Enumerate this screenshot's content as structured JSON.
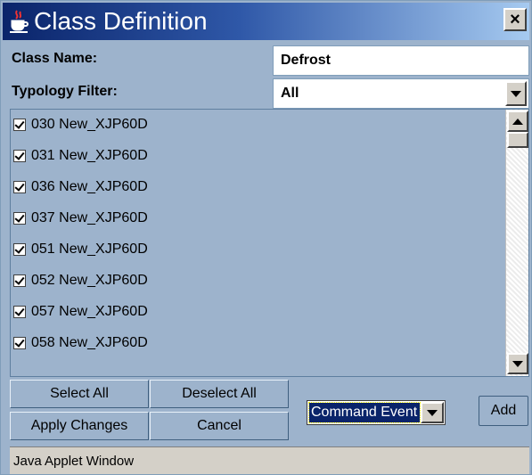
{
  "window": {
    "title": "Class Definition",
    "close_label": "×"
  },
  "form": {
    "class_name_label": "Class Name:",
    "class_name_value": "Defrost",
    "typology_filter_label": "Typology Filter:",
    "typology_filter_value": "All"
  },
  "list": {
    "items": [
      {
        "label": "030 New_XJP60D",
        "checked": true
      },
      {
        "label": "031 New_XJP60D",
        "checked": true
      },
      {
        "label": "036 New_XJP60D",
        "checked": true
      },
      {
        "label": "037 New_XJP60D",
        "checked": true
      },
      {
        "label": "051 New_XJP60D",
        "checked": true
      },
      {
        "label": "052 New_XJP60D",
        "checked": true
      },
      {
        "label": "057 New_XJP60D",
        "checked": true
      },
      {
        "label": "058 New_XJP60D",
        "checked": true
      }
    ]
  },
  "buttons": {
    "select_all": "Select All",
    "deselect_all": "Deselect All",
    "apply_changes": "Apply Changes",
    "cancel": "Cancel",
    "add": "Add"
  },
  "event_combo": {
    "value": "Command Event"
  },
  "status": {
    "text": "Java Applet Window"
  },
  "icons": {
    "title_icon": "java-coffee-cup-icon",
    "close_icon": "close-icon",
    "dropdown_icon": "chevron-down-icon",
    "scroll_up_icon": "arrow-up-icon",
    "scroll_down_icon": "arrow-down-icon",
    "checkbox_icon": "checkmark-icon"
  },
  "colors": {
    "panel": "#9db3cc",
    "titlebar_start": "#0a246a",
    "titlebar_end": "#a6caf0",
    "selection": "#0a246a"
  }
}
